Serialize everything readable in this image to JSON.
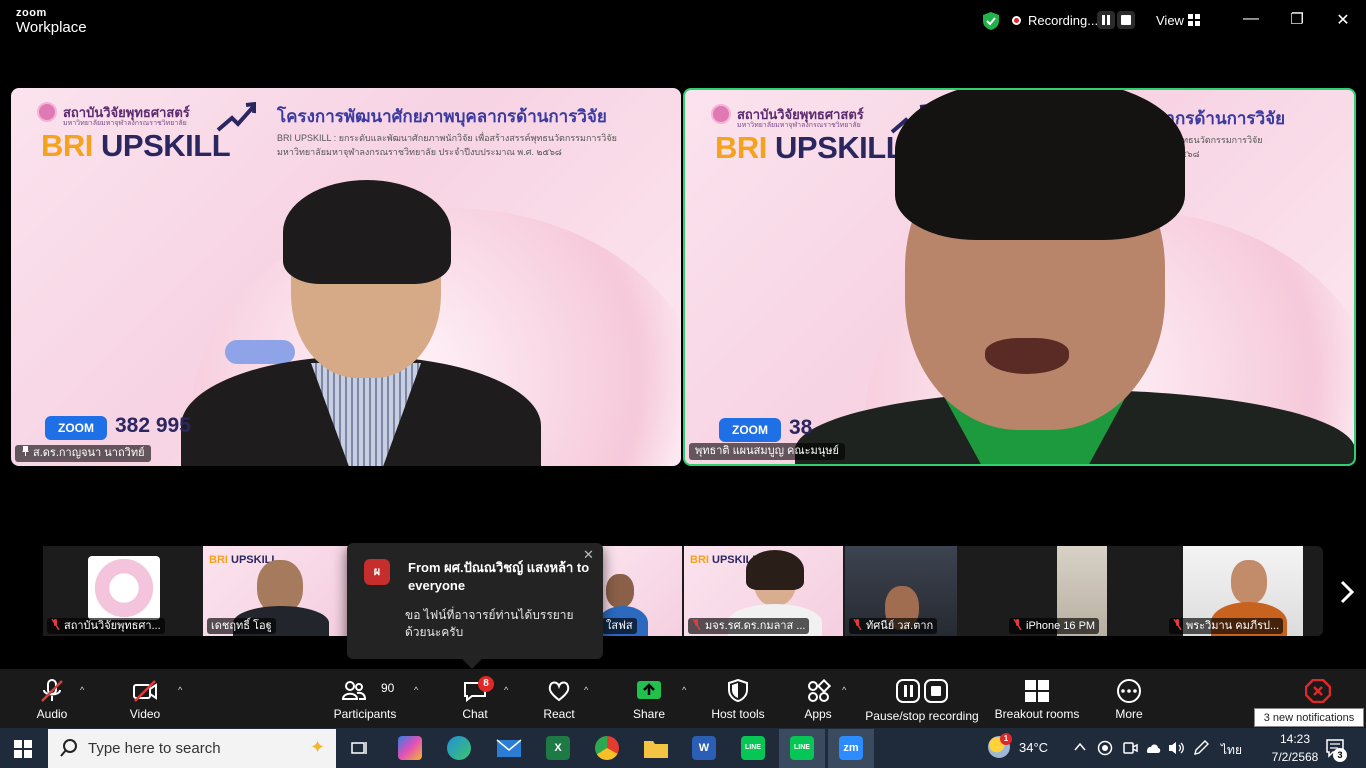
{
  "app": {
    "brand_top": "zoom",
    "brand_bottom": "Workplace"
  },
  "titlebar": {
    "recording_label": "Recording...",
    "view_label": "View",
    "minimize": "—",
    "restore": "❐",
    "close": "✕"
  },
  "slide": {
    "org": "สถาบันวิจัยพุทธศาสตร์",
    "org_sub": "มหาวิทยาลัยมหาจุฬาลงกรณราชวิทยาลัย",
    "bri": "BRI",
    "upskill": "UPSKILL",
    "headline": "โครงการพัฒนาศักยภาพบุคลากรด้านการวิจัย",
    "subline1": "BRI UPSKILL : ยกระดับและพัฒนาศักยภาพนักวิจัย เพื่อสร้างสรรค์พุทธนวัตกรรมการวิจัย",
    "subline2": "มหาวิทยาลัยมหาจุฬาลงกรณราชวิทยาลัย ประจำปีงบประมาณ พ.ศ. ๒๕๖๘",
    "zoom_badge": "ZOOM",
    "zoom_number": "382 995"
  },
  "slide_right": {
    "headline": "ลากรด้านการวิจัย",
    "subline1": "สรรค์พุทธนวัตกรรมการวิจัย",
    "subline2": "พ.ศ. ๒๕๖๘",
    "zoom_number": "38"
  },
  "tiles": {
    "left_name": "ส.ดร.กาญจนา นาถวิทย์",
    "right_name": "พุทธาติ แผนสมบูญ คณะมนุษย์"
  },
  "gallery": [
    {
      "label": "สถาบันวิจัยพุทธศา..."
    },
    {
      "label": "เดชฤทธิ์ โอฐู"
    },
    {
      "label": "ใสฟส"
    },
    {
      "label": "มจร.รศ.ดร.กมลาส ..."
    },
    {
      "label": "ทัศนีย์ วส.ตาก"
    },
    {
      "label": "iPhone 16 PM"
    },
    {
      "label": "พระวิมาน คมภีรป..."
    }
  ],
  "chat_popup": {
    "avatar": "ผ",
    "from": "From ผศ.ปัณณวิชญ์  แสงหล้า to everyone",
    "message": "ขอ ไฟน์ที่อาจารย์ท่านได้บรรยายด้วยนะครับ",
    "close": "✕"
  },
  "toolbar": {
    "audio": "Audio",
    "video": "Video",
    "participants": "Participants",
    "participants_count": "90",
    "chat": "Chat",
    "chat_badge": "8",
    "react": "React",
    "share": "Share",
    "host_tools": "Host tools",
    "apps": "Apps",
    "pause_stop_recording": "Pause/stop recording",
    "breakout_rooms": "Breakout rooms",
    "more": "More",
    "caret": "^",
    "notifications_tip": "3 new notifications"
  },
  "taskbar": {
    "search_placeholder": "Type here to search",
    "weather_temp": "34°C",
    "weather_badge": "1",
    "language": "ไทย",
    "time": "14:23",
    "date": "7/2/2568",
    "notif_count": "3",
    "apps": [
      {
        "name": "Word",
        "letter": "W"
      },
      {
        "name": "Excel",
        "letter": "X"
      },
      {
        "name": "LINE",
        "letter": "LINE"
      },
      {
        "name": "Zoom",
        "letter": "zm"
      }
    ]
  },
  "colors": {
    "accent_green": "#2fd06f",
    "toolbar_bg": "#1a1a1a",
    "record_red": "#e8202a",
    "slide_blue": "#3b3aa0"
  }
}
